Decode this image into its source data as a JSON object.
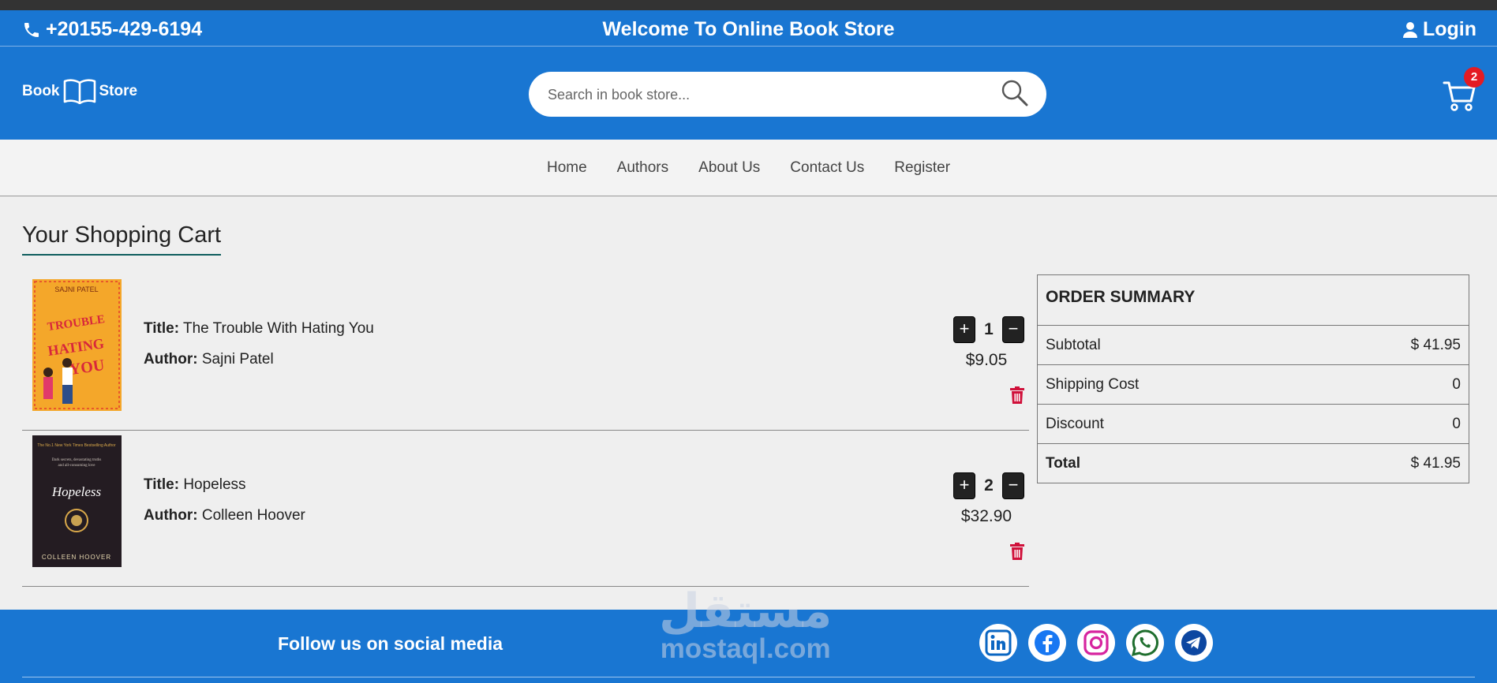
{
  "topbar": {
    "phone": "+20155-429-6194",
    "welcome": "Welcome To Online Book Store",
    "login": "Login"
  },
  "header": {
    "logo_left": "Book",
    "logo_right": "Store",
    "search_placeholder": "Search in book store...",
    "cart_count": "2"
  },
  "nav": [
    "Home",
    "Authors",
    "About Us",
    "Contact Us",
    "Register"
  ],
  "page_title": "Your Shopping Cart",
  "cart_items": [
    {
      "title_label": "Title:",
      "title": "The Trouble With Hating You",
      "author_label": "Author:",
      "author": "Sajni Patel",
      "quantity": "1",
      "price": "$9.05",
      "cover_author": "SAJNI PATEL",
      "cover_title": "THE TROUBLE with HATING YOU",
      "cover_color": "#f4a72a"
    },
    {
      "title_label": "Title:",
      "title": "Hopeless",
      "author_label": "Author:",
      "author": "Colleen Hoover",
      "quantity": "2",
      "price": "$32.90",
      "cover_author": "COLLEEN HOOVER",
      "cover_title": "Hopeless",
      "cover_color": "#241c22"
    }
  ],
  "summary": {
    "heading": "ORDER SUMMARY",
    "subtotal_label": "Subtotal",
    "subtotal": "$ 41.95",
    "shipping_label": "Shipping Cost",
    "shipping": "0",
    "discount_label": "Discount",
    "discount": "0",
    "total_label": "Total",
    "total": "$ 41.95"
  },
  "footer": {
    "follow": "Follow us on social media",
    "socials": [
      "linkedin-icon",
      "facebook-icon",
      "instagram-icon",
      "whatsapp-icon",
      "telegram-icon"
    ]
  },
  "watermark": {
    "arabic": "مستقل",
    "latin": "mostaql.com"
  },
  "colors": {
    "primary": "#1976d2",
    "badge": "#e41b23",
    "trash": "#d0103a",
    "title_underline": "#0f5e5e"
  }
}
